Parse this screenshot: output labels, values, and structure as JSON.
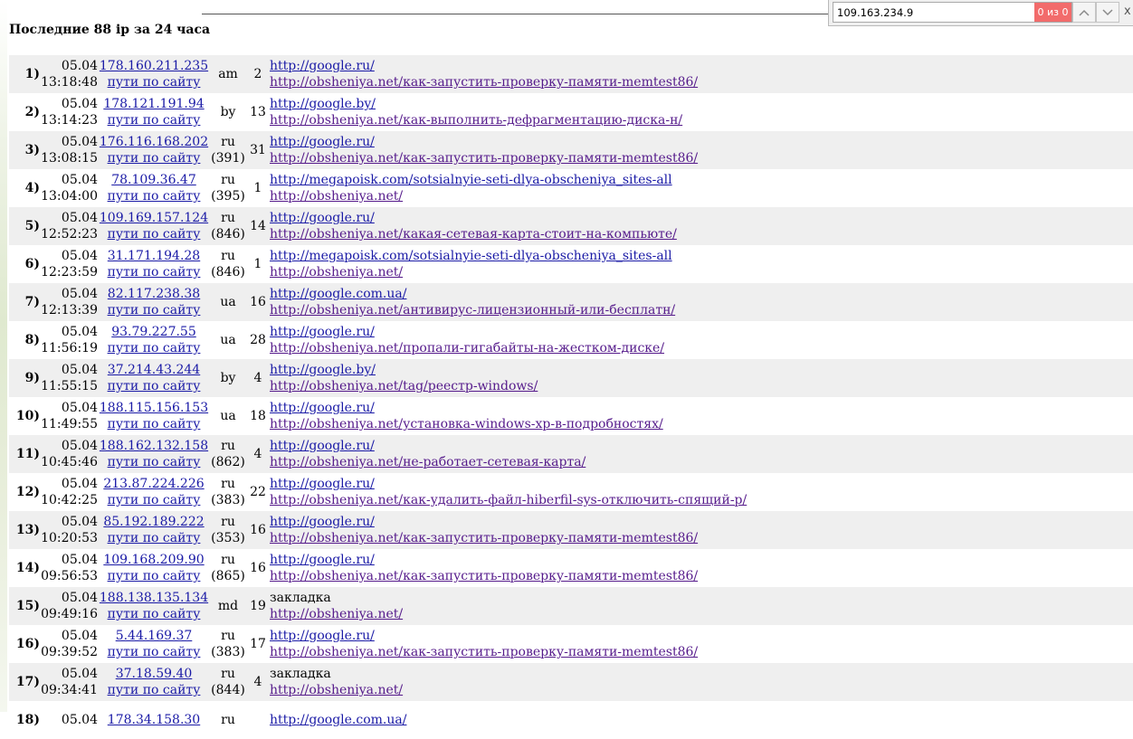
{
  "find_bar": {
    "query": "109.163.234.9",
    "match_count": "0 из 0",
    "prev_icon": "chevron-up-icon",
    "next_icon": "chevron-down-icon",
    "close_label": "x"
  },
  "page_title": "Последние 88 ip за 24 часа",
  "rows": [
    {
      "num": "1)",
      "date": "05.04",
      "time": "13:18:48",
      "ip": "178.160.211.235",
      "path_link": "пути по сайту",
      "country": "am",
      "country_sub": "",
      "count": "2",
      "ref1": "http://google.ru/",
      "ref2": "http://obsheniya.net/как-запустить-проверку-памяти-memtest86/"
    },
    {
      "num": "2)",
      "date": "05.04",
      "time": "13:14:23",
      "ip": "178.121.191.94",
      "path_link": "пути по сайту",
      "country": "by",
      "country_sub": "",
      "count": "13",
      "ref1": "http://google.by/",
      "ref2": "http://obsheniya.net/как-выполнить-дефрагментацию-диска-н/"
    },
    {
      "num": "3)",
      "date": "05.04",
      "time": "13:08:15",
      "ip": "176.116.168.202",
      "path_link": "пути по сайту",
      "country": "ru",
      "country_sub": "(391)",
      "count": "31",
      "ref1": "http://google.ru/",
      "ref2": "http://obsheniya.net/как-запустить-проверку-памяти-memtest86/"
    },
    {
      "num": "4)",
      "date": "05.04",
      "time": "13:04:00",
      "ip": "78.109.36.47",
      "path_link": "пути по сайту",
      "country": "ru",
      "country_sub": "(395)",
      "count": "1",
      "ref1": "http://megapoisk.com/sotsialnyie-seti-dlya-obscheniya_sites-all",
      "ref2": "http://obsheniya.net/"
    },
    {
      "num": "5)",
      "date": "05.04",
      "time": "12:52:23",
      "ip": "109.169.157.124",
      "path_link": "пути по сайту",
      "country": "ru",
      "country_sub": "(846)",
      "count": "14",
      "ref1": "http://google.ru/",
      "ref2": "http://obsheniya.net/какая-сетевая-карта-стоит-на-компьюте/"
    },
    {
      "num": "6)",
      "date": "05.04",
      "time": "12:23:59",
      "ip": "31.171.194.28",
      "path_link": "пути по сайту",
      "country": "ru",
      "country_sub": "(846)",
      "count": "1",
      "ref1": "http://megapoisk.com/sotsialnyie-seti-dlya-obscheniya_sites-all",
      "ref2": "http://obsheniya.net/"
    },
    {
      "num": "7)",
      "date": "05.04",
      "time": "12:13:39",
      "ip": "82.117.238.38",
      "path_link": "пути по сайту",
      "country": "ua",
      "country_sub": "",
      "count": "16",
      "ref1": "http://google.com.ua/",
      "ref2": "http://obsheniya.net/антивирус-лицензионный-или-бесплатн/"
    },
    {
      "num": "8)",
      "date": "05.04",
      "time": "11:56:19",
      "ip": "93.79.227.55",
      "path_link": "пути по сайту",
      "country": "ua",
      "country_sub": "",
      "count": "28",
      "ref1": "http://google.ru/",
      "ref2": "http://obsheniya.net/пропали-гигабайты-на-жестком-диске/"
    },
    {
      "num": "9)",
      "date": "05.04",
      "time": "11:55:15",
      "ip": "37.214.43.244",
      "path_link": "пути по сайту",
      "country": "by",
      "country_sub": "",
      "count": "4",
      "ref1": "http://google.by/",
      "ref2": "http://obsheniya.net/tag/реестр-windows/"
    },
    {
      "num": "10)",
      "date": "05.04",
      "time": "11:49:55",
      "ip": "188.115.156.153",
      "path_link": "пути по сайту",
      "country": "ua",
      "country_sub": "",
      "count": "18",
      "ref1": "http://google.ru/",
      "ref2": "http://obsheniya.net/установка-windows-xp-в-подробностях/"
    },
    {
      "num": "11)",
      "date": "05.04",
      "time": "10:45:46",
      "ip": "188.162.132.158",
      "path_link": "пути по сайту",
      "country": "ru",
      "country_sub": "(862)",
      "count": "4",
      "ref1": "http://google.ru/",
      "ref2": "http://obsheniya.net/не-работает-сетевая-карта/"
    },
    {
      "num": "12)",
      "date": "05.04",
      "time": "10:42:25",
      "ip": "213.87.224.226",
      "path_link": "пути по сайту",
      "country": "ru",
      "country_sub": "(383)",
      "count": "22",
      "ref1": "http://google.ru/",
      "ref2": "http://obsheniya.net/как-удалить-файл-hiberfil-sys-отключить-спящий-р/"
    },
    {
      "num": "13)",
      "date": "05.04",
      "time": "10:20:53",
      "ip": "85.192.189.222",
      "path_link": "пути по сайту",
      "country": "ru",
      "country_sub": "(353)",
      "count": "16",
      "ref1": "http://google.ru/",
      "ref2": "http://obsheniya.net/как-запустить-проверку-памяти-memtest86/"
    },
    {
      "num": "14)",
      "date": "05.04",
      "time": "09:56:53",
      "ip": "109.168.209.90",
      "path_link": "пути по сайту",
      "country": "ru",
      "country_sub": "(865)",
      "count": "16",
      "ref1": "http://google.ru/",
      "ref2": "http://obsheniya.net/как-запустить-проверку-памяти-memtest86/"
    },
    {
      "num": "15)",
      "date": "05.04",
      "time": "09:49:16",
      "ip": "188.138.135.134",
      "path_link": "пути по сайту",
      "country": "md",
      "country_sub": "",
      "count": "19",
      "ref1": "закладка",
      "ref2": "http://obsheniya.net/"
    },
    {
      "num": "16)",
      "date": "05.04",
      "time": "09:39:52",
      "ip": "5.44.169.37",
      "path_link": "пути по сайту",
      "country": "ru",
      "country_sub": "(383)",
      "count": "17",
      "ref1": "http://google.ru/",
      "ref2": "http://obsheniya.net/как-запустить-проверку-памяти-memtest86/"
    },
    {
      "num": "17)",
      "date": "05.04",
      "time": "09:34:41",
      "ip": "37.18.59.40",
      "path_link": "пути по сайту",
      "country": "ru",
      "country_sub": "(844)",
      "count": "4",
      "ref1": "закладка",
      "ref2": "http://obsheniya.net/"
    },
    {
      "num": "18)",
      "date": "05.04",
      "time": "",
      "ip": "178.34.158.30",
      "path_link": "",
      "country": "ru",
      "country_sub": "",
      "count": "",
      "ref1": "http://google.com.ua/",
      "ref2": ""
    }
  ]
}
